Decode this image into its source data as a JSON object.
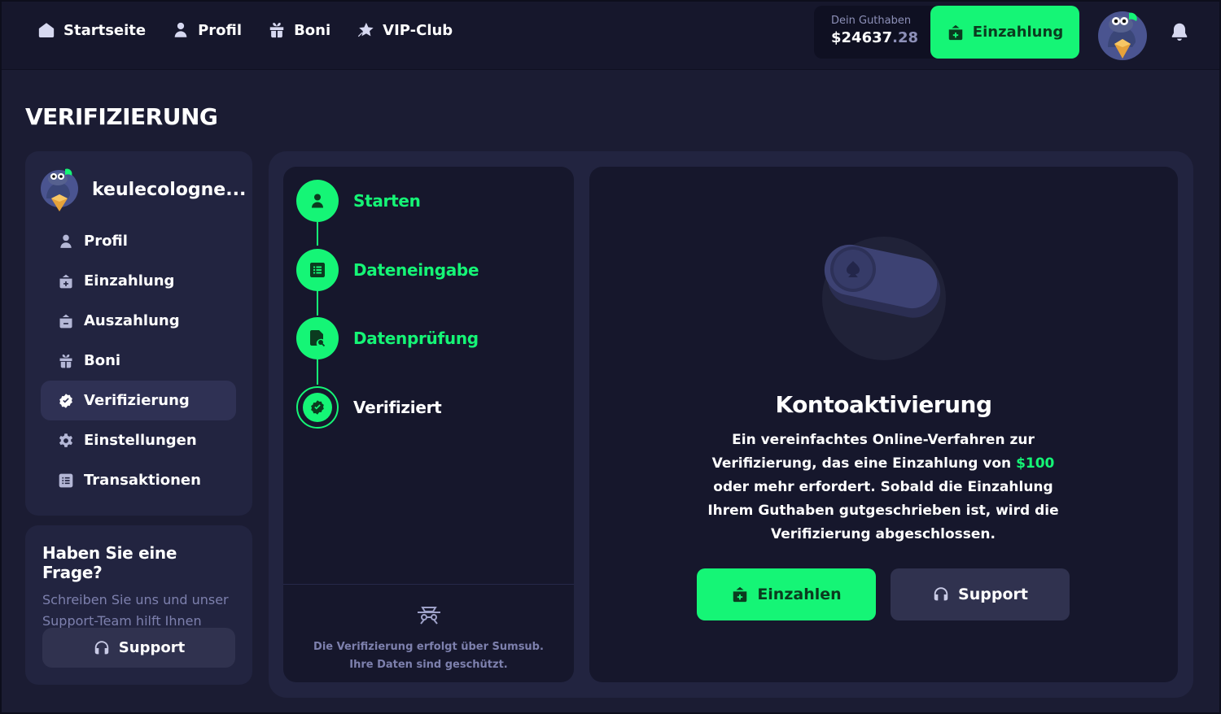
{
  "colors": {
    "accent": "#15f576",
    "background": "#1b1c33",
    "panel": "#16172c",
    "card": "#222440",
    "muted": "#7d80ad"
  },
  "nav": {
    "items": [
      {
        "label": "Startseite",
        "icon": "home-icon"
      },
      {
        "label": "Profil",
        "icon": "user-icon"
      },
      {
        "label": "Boni",
        "icon": "gift-icon"
      },
      {
        "label": "VIP-Club",
        "icon": "star-icon"
      }
    ]
  },
  "balance": {
    "label": "Dein Guthaben",
    "whole": "$24637",
    "cents": ".28"
  },
  "header": {
    "deposit_label": "Einzahlung"
  },
  "page": {
    "title": "VERIFIZIERUNG"
  },
  "sidebar": {
    "username": "keulecologne...",
    "items": [
      {
        "label": "Profil",
        "icon": "user-icon"
      },
      {
        "label": "Einzahlung",
        "icon": "wallet-plus-icon"
      },
      {
        "label": "Auszahlung",
        "icon": "wallet-minus-icon"
      },
      {
        "label": "Boni",
        "icon": "gift-icon"
      },
      {
        "label": "Verifizierung",
        "icon": "verified-badge-icon",
        "active": true
      },
      {
        "label": "Einstellungen",
        "icon": "gear-icon"
      },
      {
        "label": "Transaktionen",
        "icon": "list-icon"
      }
    ]
  },
  "help": {
    "title": "Haben Sie eine Frage?",
    "text": "Schreiben Sie uns und unser Support-Team hilft Ihnen",
    "button": "Support"
  },
  "steps": {
    "items": [
      {
        "label": "Starten",
        "icon": "user-icon",
        "state": "done"
      },
      {
        "label": "Dateneingabe",
        "icon": "form-icon",
        "state": "done"
      },
      {
        "label": "Datenprüfung",
        "icon": "document-search-icon",
        "state": "done"
      },
      {
        "label": "Verifiziert",
        "icon": "check-badge-icon",
        "state": "current"
      }
    ],
    "note": "Die Verifizierung erfolgt über Sumsub. Ihre Daten sind geschützt."
  },
  "info": {
    "title": "Kontoaktivierung",
    "text_before": "Ein vereinfachtes Online-Verfahren zur Verifizierung, das eine Einzahlung von ",
    "amount": "$100",
    "text_after": " oder mehr erfordert. Sobald die Einzahlung Ihrem Guthaben gutgeschrieben ist, wird die Verifizierung abgeschlossen.",
    "deposit_button": "Einzahlen",
    "support_button": "Support"
  }
}
